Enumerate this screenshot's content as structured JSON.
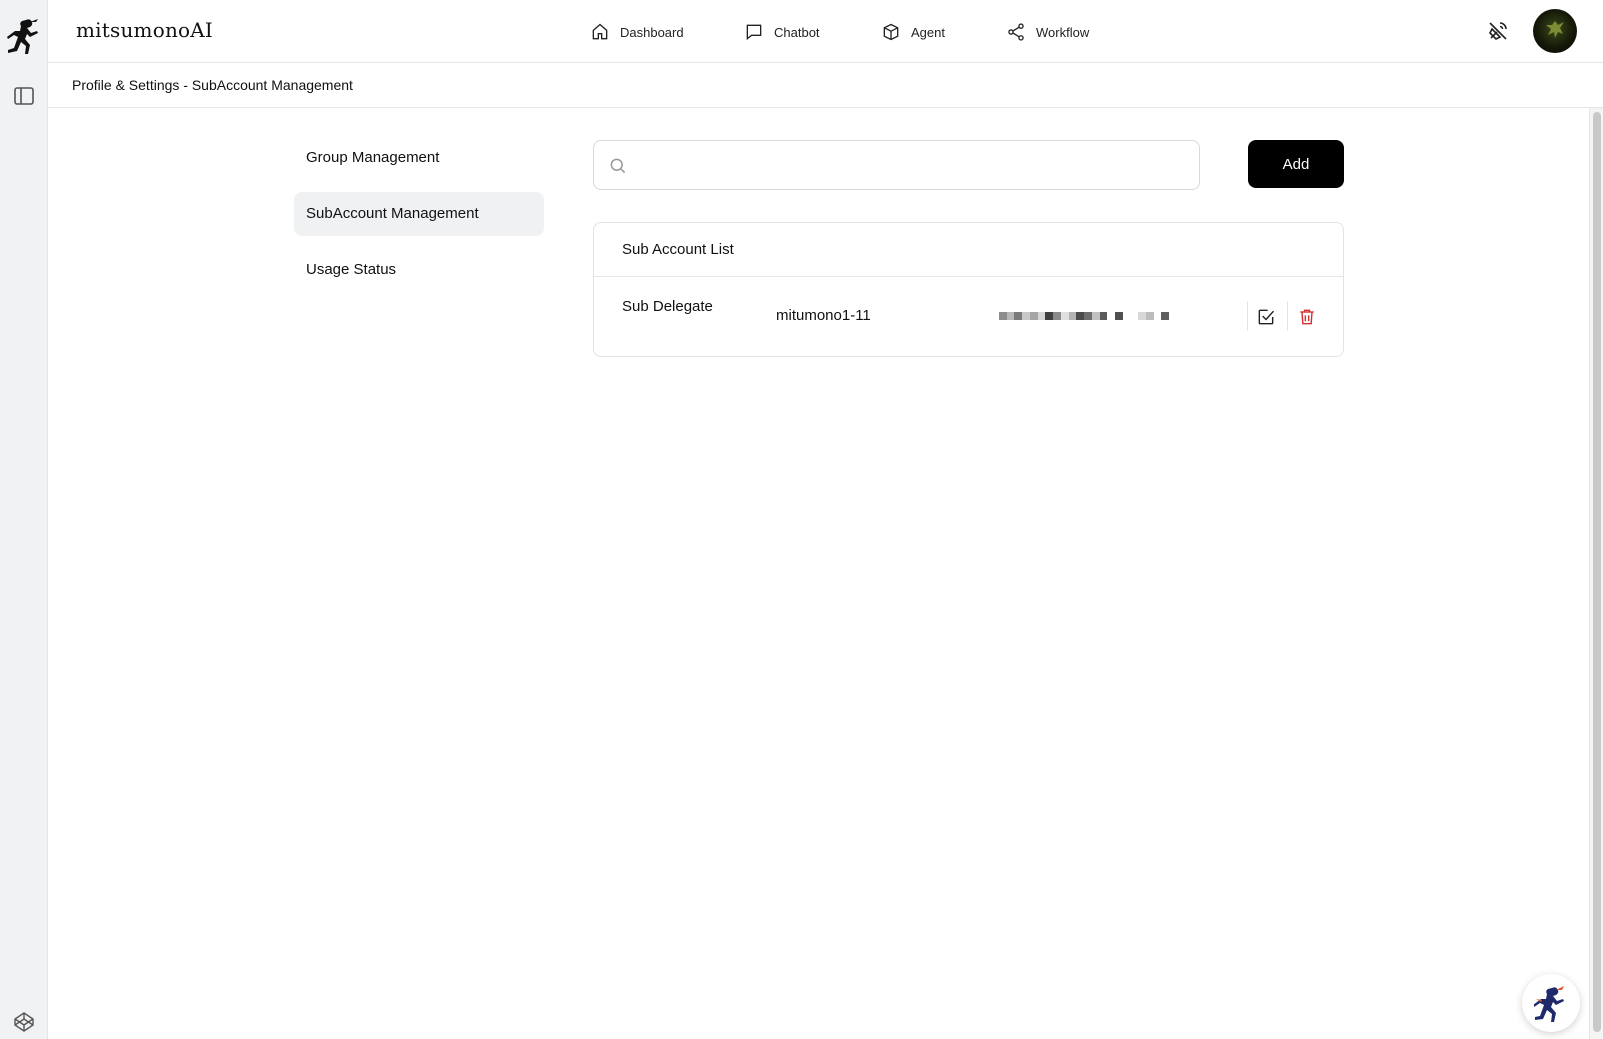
{
  "app": {
    "brand": "mitsumonoAI"
  },
  "nav": [
    {
      "label": "Dashboard",
      "icon": "home-icon"
    },
    {
      "label": "Chatbot",
      "icon": "chat-bubble-icon"
    },
    {
      "label": "Agent",
      "icon": "cube-icon"
    },
    {
      "label": "Workflow",
      "icon": "share-nodes-icon"
    }
  ],
  "header": {
    "breadcrumb": "Profile & Settings - SubAccount Management"
  },
  "settings_menu": [
    {
      "label": "Group Management",
      "active": false
    },
    {
      "label": "SubAccount Management",
      "active": true
    },
    {
      "label": "Usage Status",
      "active": false
    }
  ],
  "search": {
    "placeholder": "",
    "value": ""
  },
  "toolbar": {
    "add_label": "Add"
  },
  "sub_account_list": {
    "title": "Sub Account List",
    "rows": [
      {
        "role": "Sub Delegate",
        "username": "mitumono1-11",
        "email_masked": true
      }
    ]
  },
  "colors": {
    "primary_button": "#000000",
    "delete_icon": "#d32f2f",
    "active_menu_bg": "#f0f1f3"
  }
}
